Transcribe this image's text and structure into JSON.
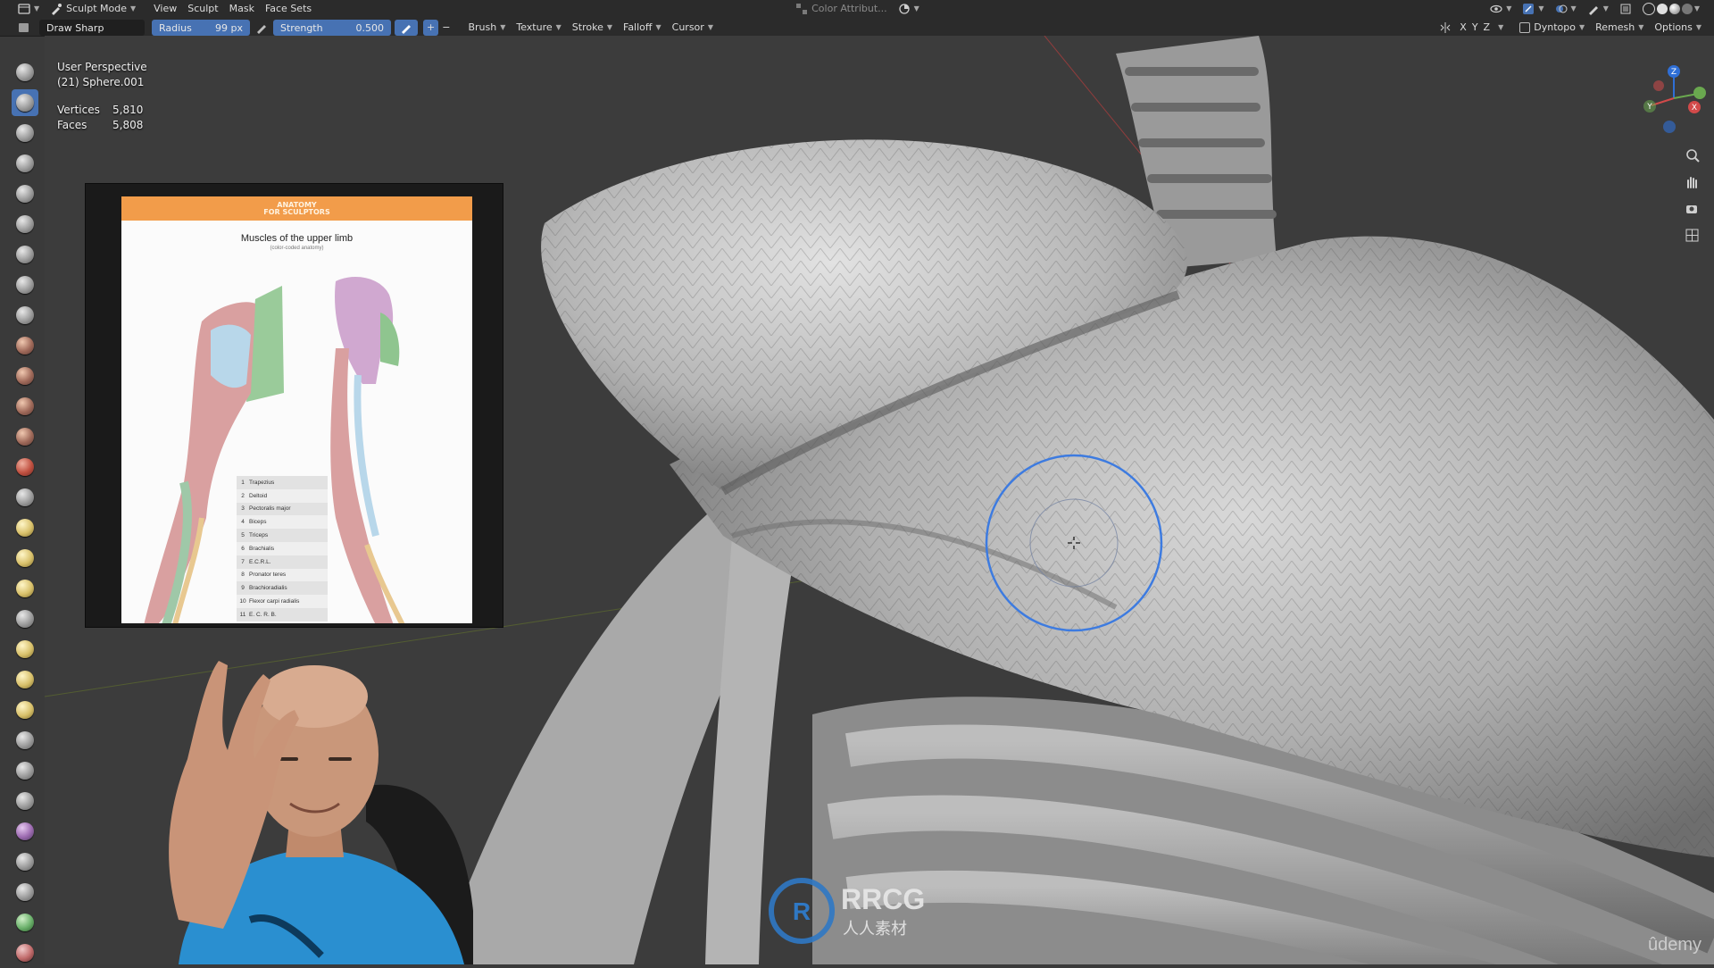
{
  "header": {
    "mode": "Sculpt Mode",
    "menus": [
      "View",
      "Sculpt",
      "Mask",
      "Face Sets"
    ],
    "color_attr": "Color Attribut...",
    "brush_name": "Draw Sharp",
    "radius_label": "Radius",
    "radius_value": "99 px",
    "strength_label": "Strength",
    "strength_value": "0.500",
    "plus": "+",
    "minus": "−",
    "dropdowns": [
      "Brush",
      "Texture",
      "Stroke",
      "Falloff",
      "Cursor"
    ],
    "axes": [
      "X",
      "Y",
      "Z"
    ],
    "dyntopo": "Dyntopo",
    "remesh": "Remesh",
    "options": "Options"
  },
  "viewport": {
    "perspective": "User Perspective",
    "object": "(21) Sphere.001",
    "stats": [
      {
        "label": "Vertices",
        "value": "5,810"
      },
      {
        "label": "Faces",
        "value": "5,808"
      }
    ]
  },
  "reference": {
    "band_text": "ANATOMY\nFOR SCULPTORS",
    "title": "Muscles of the upper limb",
    "subtitle": "(color-coded anatomy)",
    "legend": [
      {
        "n": "1",
        "name": "Trapezius"
      },
      {
        "n": "2",
        "name": "Deltoid"
      },
      {
        "n": "3",
        "name": "Pectoralis major"
      },
      {
        "n": "4",
        "name": "Biceps"
      },
      {
        "n": "5",
        "name": "Triceps"
      },
      {
        "n": "6",
        "name": "Brachialis"
      },
      {
        "n": "7",
        "name": "E.C.R.L."
      },
      {
        "n": "8",
        "name": "Pronator teres"
      },
      {
        "n": "9",
        "name": "Brachioradialis"
      },
      {
        "n": "10",
        "name": "Flexor carpi radialis"
      },
      {
        "n": "11",
        "name": "E. C. R. B."
      }
    ]
  },
  "gizmo": {
    "x": "X",
    "y": "Y",
    "z": "Z"
  },
  "watermark": {
    "brand": "RRCG",
    "cn": "人人素材",
    "udemy": "ûdemy"
  },
  "colors": {
    "accent": "#4772b3",
    "header": "#2b2b2b",
    "brush_circle": "#3d7be0"
  }
}
